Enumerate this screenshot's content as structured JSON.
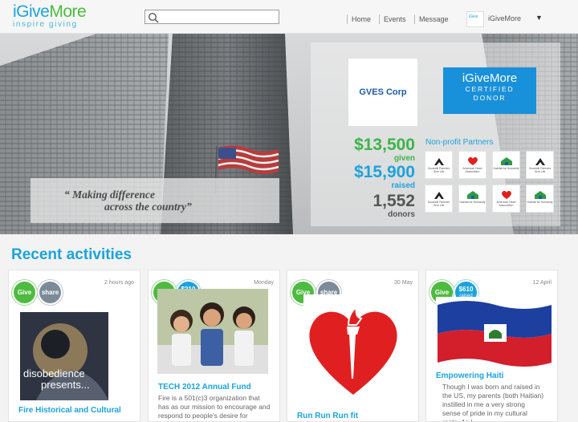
{
  "header": {
    "logo_main_a": "iGive",
    "logo_main_b": "More",
    "logo_tagline": "inspire giving",
    "search_placeholder": "",
    "nav": [
      "Home",
      "Events",
      "Message"
    ],
    "user_name": "iGiveMore",
    "user_menu_caret": "▼"
  },
  "hero": {
    "quote_line1": "“ Making difference",
    "quote_line2": "across the country”",
    "corp_name": "GVES Corp",
    "cert_brand": "iGiveMore",
    "cert_line1": "CERTIFIED",
    "cert_line2": "DONOR",
    "stats": [
      {
        "value": "$13,500",
        "label": "given",
        "color": "#3cb44b"
      },
      {
        "value": "$15,900",
        "label": "raised",
        "color": "#1ba3dd"
      },
      {
        "value": "1,552",
        "label": "donors",
        "color": "#555555"
      }
    ],
    "partners_label": "Non-profit Partners",
    "partners": [
      {
        "kind": "goodwill",
        "text": "Goodwill Partners Give Life"
      },
      {
        "kind": "heart",
        "text": "American Heart Association"
      },
      {
        "kind": "habitat",
        "text": "Habitat for Humanity"
      },
      {
        "kind": "goodwill",
        "text": "Goodwill Partners Give Life"
      },
      {
        "kind": "goodwill",
        "text": "Goodwill Partners Give Life"
      },
      {
        "kind": "habitat",
        "text": "Habitat for Humanity"
      },
      {
        "kind": "heart",
        "text": "American Heart Association"
      },
      {
        "kind": "habitat",
        "text": "Habitat for Humanity"
      }
    ]
  },
  "activities": {
    "title": "Recent activities",
    "cards": [
      {
        "badge1": "Give",
        "badge2": "share",
        "time": "2 hours ago",
        "title": "Fire Historical and Cultural",
        "image_text_1": "disobedience",
        "image_text_2": "presents..."
      },
      {
        "badge1": "Give",
        "badge2_amount": "$210",
        "badge2_label": "raised",
        "time": "Monday",
        "title": "TECH 2012 Annual Fund",
        "desc": "Fire is a 501(c)3 organization that has as our mission to encourage and respond to people's desire for"
      },
      {
        "badge1": "Give",
        "badge2": "share",
        "time": "30 May",
        "title": "Run Run Run fit"
      },
      {
        "badge1": "Give",
        "badge2_amount": "$610",
        "badge2_label": "raised",
        "time": "12 April",
        "title": "Empowering Haiti",
        "desc": "Though I was born and raised in the US, my parents (both Haitian) instilled in me a very strong sense of pride in my cultural roots. As I"
      }
    ]
  }
}
